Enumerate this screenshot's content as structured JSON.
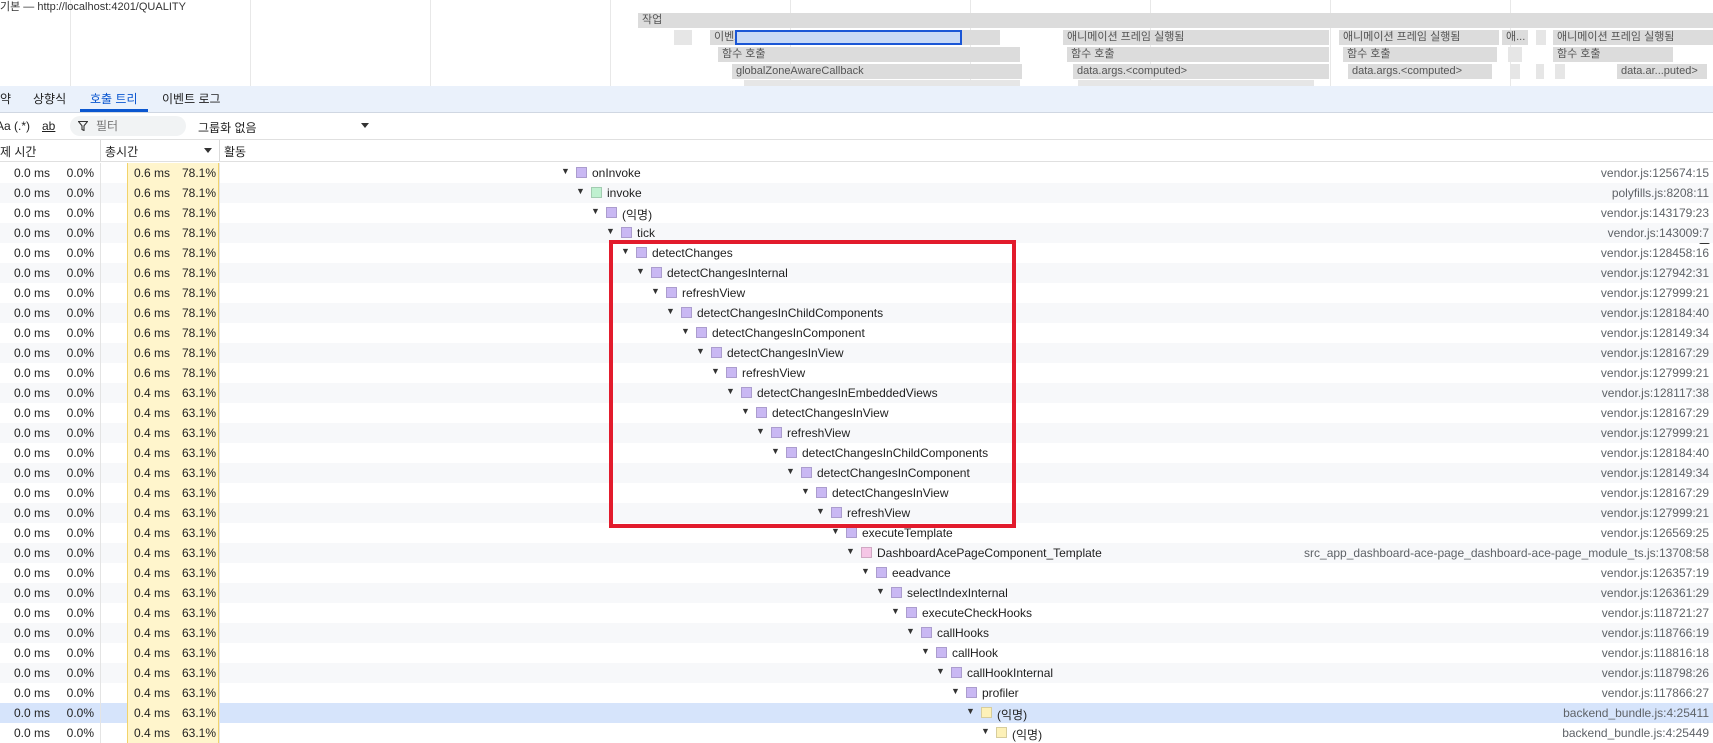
{
  "flame": {
    "url_text": "기본 — http://localhost:4201/QUALITY",
    "blocks": [
      {
        "text": "작업"
      },
      {
        "text": "이벤트: mousemove"
      },
      {
        "text": "함수 호출"
      },
      {
        "text": "globalZoneAwareCallback"
      },
      {
        "text": "애니메이션 프레임 실행됨"
      },
      {
        "text": "함수 호출"
      },
      {
        "text": "data.args.<computed>"
      },
      {
        "text": "애니메이션 프레임 실행됨"
      },
      {
        "text": "함수 호출"
      },
      {
        "text": "data.args.<computed>"
      },
      {
        "text": "애..."
      },
      {
        "text": "애니메이션 프레임 실행됨"
      },
      {
        "text": "함수 호출"
      },
      {
        "text": "data.ar...puted>"
      }
    ]
  },
  "tabs": [
    "약",
    "상향식",
    "호출 트리",
    "이벤트 로그"
  ],
  "active_tab": "호출 트리",
  "toolbar": {
    "match_case": "Aa",
    "regex": "(.*)",
    "whole_word": "ab",
    "filter_placeholder": "필터",
    "grouping": "그룹화 없음"
  },
  "header": {
    "self_time": "제 시간",
    "total_time": "총시간",
    "activity": "활동"
  },
  "colors": {
    "accent": "#0b57d0",
    "highlight_box": "#e21b2c",
    "total_bg": "#fff5cc",
    "js_square": "#c9b8f3",
    "gc_square": "#bff0d0",
    "template_square": "#f5c6e6",
    "anon_square": "#fdf1b8"
  },
  "rows": [
    {
      "self_ms": "0.0 ms",
      "self_pct": "0.0%",
      "total_ms": "0.6 ms",
      "total_pct": "78.1%",
      "depth": 0,
      "name": "onInvoke",
      "color": "purple",
      "source": "vendor.js:125674:15"
    },
    {
      "self_ms": "0.0 ms",
      "self_pct": "0.0%",
      "total_ms": "0.6 ms",
      "total_pct": "78.1%",
      "depth": 1,
      "name": "invoke",
      "color": "green",
      "source": "polyfills.js:8208:11"
    },
    {
      "self_ms": "0.0 ms",
      "self_pct": "0.0%",
      "total_ms": "0.6 ms",
      "total_pct": "78.1%",
      "depth": 2,
      "name": "(익명)",
      "color": "purple",
      "source": "vendor.js:143179:23"
    },
    {
      "self_ms": "0.0 ms",
      "self_pct": "0.0%",
      "total_ms": "0.6 ms",
      "total_pct": "78.1%",
      "depth": 3,
      "name": "tick",
      "color": "purple",
      "source": "vendor.js:143009:7"
    },
    {
      "self_ms": "0.0 ms",
      "self_pct": "0.0%",
      "total_ms": "0.6 ms",
      "total_pct": "78.1%",
      "depth": 4,
      "name": "detectChanges",
      "color": "purple",
      "source": "vendor.js:128458:16"
    },
    {
      "self_ms": "0.0 ms",
      "self_pct": "0.0%",
      "total_ms": "0.6 ms",
      "total_pct": "78.1%",
      "depth": 5,
      "name": "detectChangesInternal",
      "color": "purple",
      "source": "vendor.js:127942:31"
    },
    {
      "self_ms": "0.0 ms",
      "self_pct": "0.0%",
      "total_ms": "0.6 ms",
      "total_pct": "78.1%",
      "depth": 6,
      "name": "refreshView",
      "color": "purple",
      "source": "vendor.js:127999:21"
    },
    {
      "self_ms": "0.0 ms",
      "self_pct": "0.0%",
      "total_ms": "0.6 ms",
      "total_pct": "78.1%",
      "depth": 7,
      "name": "detectChangesInChildComponents",
      "color": "purple",
      "source": "vendor.js:128184:40"
    },
    {
      "self_ms": "0.0 ms",
      "self_pct": "0.0%",
      "total_ms": "0.6 ms",
      "total_pct": "78.1%",
      "depth": 8,
      "name": "detectChangesInComponent",
      "color": "purple",
      "source": "vendor.js:128149:34"
    },
    {
      "self_ms": "0.0 ms",
      "self_pct": "0.0%",
      "total_ms": "0.6 ms",
      "total_pct": "78.1%",
      "depth": 9,
      "name": "detectChangesInView",
      "color": "purple",
      "source": "vendor.js:128167:29"
    },
    {
      "self_ms": "0.0 ms",
      "self_pct": "0.0%",
      "total_ms": "0.6 ms",
      "total_pct": "78.1%",
      "depth": 10,
      "name": "refreshView",
      "color": "purple",
      "source": "vendor.js:127999:21"
    },
    {
      "self_ms": "0.0 ms",
      "self_pct": "0.0%",
      "total_ms": "0.4 ms",
      "total_pct": "63.1%",
      "depth": 11,
      "name": "detectChangesInEmbeddedViews",
      "color": "purple",
      "source": "vendor.js:128117:38"
    },
    {
      "self_ms": "0.0 ms",
      "self_pct": "0.0%",
      "total_ms": "0.4 ms",
      "total_pct": "63.1%",
      "depth": 12,
      "name": "detectChangesInView",
      "color": "purple",
      "source": "vendor.js:128167:29"
    },
    {
      "self_ms": "0.0 ms",
      "self_pct": "0.0%",
      "total_ms": "0.4 ms",
      "total_pct": "63.1%",
      "depth": 13,
      "name": "refreshView",
      "color": "purple",
      "source": "vendor.js:127999:21"
    },
    {
      "self_ms": "0.0 ms",
      "self_pct": "0.0%",
      "total_ms": "0.4 ms",
      "total_pct": "63.1%",
      "depth": 14,
      "name": "detectChangesInChildComponents",
      "color": "purple",
      "source": "vendor.js:128184:40"
    },
    {
      "self_ms": "0.0 ms",
      "self_pct": "0.0%",
      "total_ms": "0.4 ms",
      "total_pct": "63.1%",
      "depth": 15,
      "name": "detectChangesInComponent",
      "color": "purple",
      "source": "vendor.js:128149:34"
    },
    {
      "self_ms": "0.0 ms",
      "self_pct": "0.0%",
      "total_ms": "0.4 ms",
      "total_pct": "63.1%",
      "depth": 16,
      "name": "detectChangesInView",
      "color": "purple",
      "source": "vendor.js:128167:29"
    },
    {
      "self_ms": "0.0 ms",
      "self_pct": "0.0%",
      "total_ms": "0.4 ms",
      "total_pct": "63.1%",
      "depth": 17,
      "name": "refreshView",
      "color": "purple",
      "source": "vendor.js:127999:21"
    },
    {
      "self_ms": "0.0 ms",
      "self_pct": "0.0%",
      "total_ms": "0.4 ms",
      "total_pct": "63.1%",
      "depth": 18,
      "name": "executeTemplate",
      "color": "purple",
      "source": "vendor.js:126569:25"
    },
    {
      "self_ms": "0.0 ms",
      "self_pct": "0.0%",
      "total_ms": "0.4 ms",
      "total_pct": "63.1%",
      "depth": 19,
      "name": "DashboardAcePageComponent_Template",
      "color": "pink",
      "source": "src_app_dashboard-ace-page_dashboard-ace-page_module_ts.js:13708:58"
    },
    {
      "self_ms": "0.0 ms",
      "self_pct": "0.0%",
      "total_ms": "0.4 ms",
      "total_pct": "63.1%",
      "depth": 20,
      "name": "eeadvance",
      "color": "purple",
      "source": "vendor.js:126357:19"
    },
    {
      "self_ms": "0.0 ms",
      "self_pct": "0.0%",
      "total_ms": "0.4 ms",
      "total_pct": "63.1%",
      "depth": 21,
      "name": "selectIndexInternal",
      "color": "purple",
      "source": "vendor.js:126361:29"
    },
    {
      "self_ms": "0.0 ms",
      "self_pct": "0.0%",
      "total_ms": "0.4 ms",
      "total_pct": "63.1%",
      "depth": 22,
      "name": "executeCheckHooks",
      "color": "purple",
      "source": "vendor.js:118721:27"
    },
    {
      "self_ms": "0.0 ms",
      "self_pct": "0.0%",
      "total_ms": "0.4 ms",
      "total_pct": "63.1%",
      "depth": 23,
      "name": "callHooks",
      "color": "purple",
      "source": "vendor.js:118766:19"
    },
    {
      "self_ms": "0.0 ms",
      "self_pct": "0.0%",
      "total_ms": "0.4 ms",
      "total_pct": "63.1%",
      "depth": 24,
      "name": "callHook",
      "color": "purple",
      "source": "vendor.js:118816:18"
    },
    {
      "self_ms": "0.0 ms",
      "self_pct": "0.0%",
      "total_ms": "0.4 ms",
      "total_pct": "63.1%",
      "depth": 25,
      "name": "callHookInternal",
      "color": "purple",
      "source": "vendor.js:118798:26"
    },
    {
      "self_ms": "0.0 ms",
      "self_pct": "0.0%",
      "total_ms": "0.4 ms",
      "total_pct": "63.1%",
      "depth": 26,
      "name": "profiler",
      "color": "purple",
      "source": "vendor.js:117866:27"
    },
    {
      "self_ms": "0.0 ms",
      "self_pct": "0.0%",
      "total_ms": "0.4 ms",
      "total_pct": "63.1%",
      "depth": 27,
      "name": "(익명)",
      "color": "yellow",
      "source": "backend_bundle.js:4:25411",
      "selected": true
    },
    {
      "self_ms": "0.0 ms",
      "self_pct": "0.0%",
      "total_ms": "0.4 ms",
      "total_pct": "63.1%",
      "depth": 28,
      "name": "(익명)",
      "color": "yellow",
      "source": "backend_bundle.js:4:25449"
    }
  ]
}
